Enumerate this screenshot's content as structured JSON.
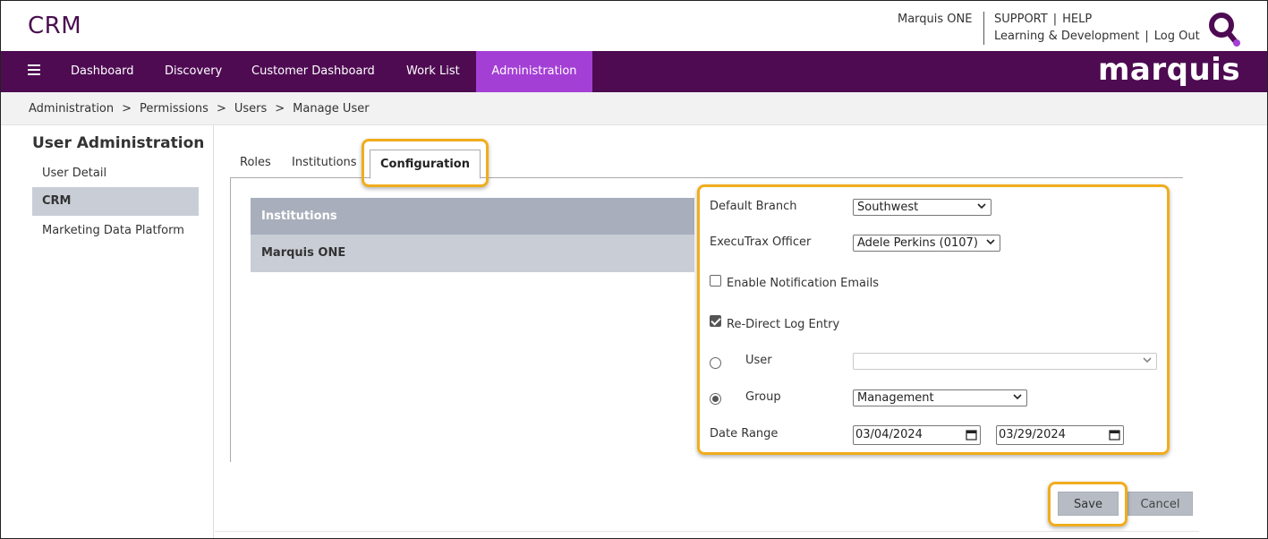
{
  "header": {
    "app_title": "CRM",
    "marquis_one": "Marquis ONE",
    "support": "SUPPORT",
    "help": "HELP",
    "learning": "Learning & Development",
    "logout": "Log Out",
    "separator": "|",
    "brand": "marquis"
  },
  "nav": {
    "items": [
      {
        "label": "Dashboard"
      },
      {
        "label": "Discovery"
      },
      {
        "label": "Customer Dashboard"
      },
      {
        "label": "Work List"
      },
      {
        "label": "Administration"
      }
    ],
    "active_color": "#a43fd6",
    "bar_color": "#4e0b52"
  },
  "breadcrumb": {
    "items": [
      "Administration",
      "Permissions",
      "Users",
      "Manage User"
    ],
    "separator": ">"
  },
  "sidebar": {
    "title": "User Administration",
    "items": [
      {
        "label": "User Detail"
      },
      {
        "label": "CRM"
      },
      {
        "label": "Marketing Data Platform"
      }
    ]
  },
  "tabs": {
    "roles": "Roles",
    "institutions": "Institutions",
    "configuration": "Configuration"
  },
  "institutions_table": {
    "header": "Institutions",
    "rows": [
      "Marquis ONE"
    ]
  },
  "form": {
    "default_branch_label": "Default Branch",
    "default_branch_value": "Southwest",
    "executrax_officer_label": "ExecuTrax Officer",
    "executrax_officer_value": "Adele Perkins (0107)",
    "enable_notification_label": "Enable Notification Emails",
    "enable_notification_checked": false,
    "redirect_log_label": "Re-Direct Log Entry",
    "redirect_log_checked": true,
    "user_label": "User",
    "user_value": "",
    "group_label": "Group",
    "group_value": "Management",
    "redirect_target": "Group",
    "date_range_label": "Date Range",
    "date_from": "03/04/2024",
    "date_to": "03/29/2024"
  },
  "actions": {
    "save": "Save",
    "cancel": "Cancel"
  },
  "highlight_color": "#f0ad1c"
}
